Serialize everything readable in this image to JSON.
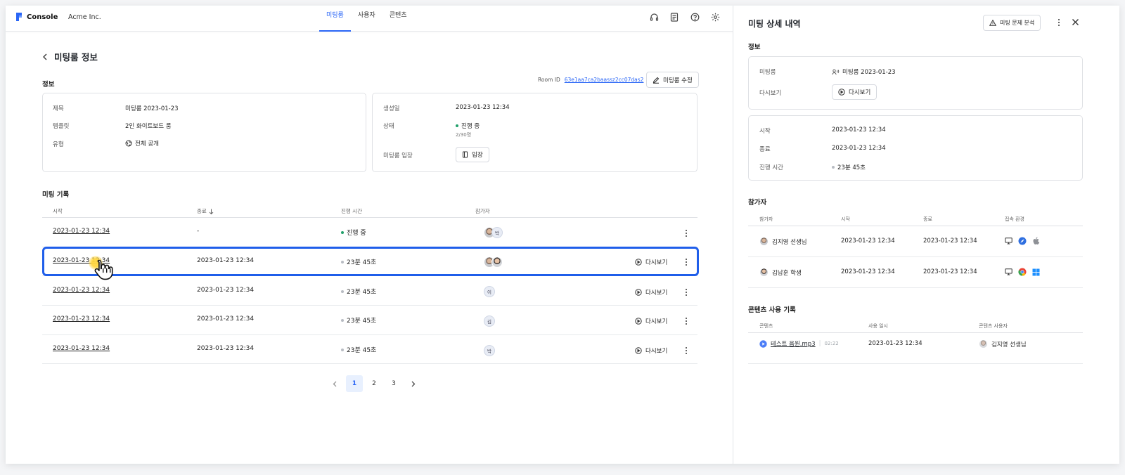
{
  "app": {
    "logo_text": "Console",
    "org_name": "Acme Inc."
  },
  "nav": {
    "tabs": [
      {
        "label": "미팅룸",
        "active": true
      },
      {
        "label": "사용자",
        "active": false
      },
      {
        "label": "콘텐츠",
        "active": false
      }
    ],
    "icons": [
      "headset-icon",
      "document-icon",
      "help-icon",
      "settings-icon"
    ]
  },
  "page": {
    "title": "미팅룸 정보",
    "info_section": "정보",
    "room_id_label": "Room ID",
    "room_id_value": "63e1aa7ca2baassz2cc07das2",
    "edit_button": "미팅룸 수정"
  },
  "info_left": {
    "title_label": "제목",
    "title_value": "미팅룸 2023-01-23",
    "template_label": "템플릿",
    "template_value": "2인 화이트보드 룸",
    "type_label": "유형",
    "type_value": "전체 공개"
  },
  "info_right": {
    "created_label": "생성일",
    "created_value": "2023-01-23 12:34",
    "status_label": "상태",
    "status_value": "진행 중",
    "status_count": "2/30명",
    "enter_label": "미팅룸 입장",
    "enter_button": "입장"
  },
  "records": {
    "section": "미팅 기록",
    "headers": {
      "start": "시작",
      "end": "종료",
      "duration": "진행 시간",
      "participants": "참가자"
    },
    "replay_label": "다시보기",
    "rows": [
      {
        "start": "2023-01-23 12:34",
        "end": "-",
        "duration": "진행 중",
        "live": true,
        "chips": [
          "박"
        ]
      },
      {
        "start": "2023-01-23 12:34",
        "end": "2023-01-23 12:34",
        "duration": "23분 45초",
        "live": false,
        "chips": []
      },
      {
        "start": "2023-01-23 12:34",
        "end": "2023-01-23 12:34",
        "duration": "23분 45초",
        "live": false,
        "chips": [
          "이"
        ]
      },
      {
        "start": "2023-01-23 12:34",
        "end": "2023-01-23 12:34",
        "duration": "23분 45초",
        "live": false,
        "chips": [
          "김"
        ]
      },
      {
        "start": "2023-01-23 12:34",
        "end": "2023-01-23 12:34",
        "duration": "23분 45초",
        "live": false,
        "chips": [
          "박"
        ]
      }
    ],
    "selected_row": 2
  },
  "pagination": {
    "pages": [
      "1",
      "2",
      "3"
    ],
    "current": "1"
  },
  "drawer": {
    "title": "미팅 상세 내역",
    "analyze_button": "미팅 문제 분석",
    "info_section": "정보",
    "room_label": "미팅룸",
    "room_value": "미팅룸 2023-01-23",
    "replay_label": "다시보기",
    "replay_button": "다시보기",
    "start_label": "시작",
    "start_value": "2023-01-23 12:34",
    "end_label": "종료",
    "end_value": "2023-01-23 12:34",
    "duration_label": "진행 시간",
    "duration_value": "23분 45초",
    "participants_section": "참가자",
    "participants_headers": {
      "name": "참가자",
      "start": "시작",
      "end": "종료",
      "env": "접속 환경"
    },
    "participants": [
      {
        "name": "김지영 선생님",
        "start": "2023-01-23 12:34",
        "end": "2023-01-23 12:34",
        "env": [
          "desktop-icon",
          "safari-icon",
          "apple-icon"
        ]
      },
      {
        "name": "김남훈 학생",
        "start": "2023-01-23 12:34",
        "end": "2023-01-23 12:34",
        "env": [
          "desktop-icon",
          "chrome-icon",
          "windows-icon"
        ]
      }
    ],
    "content_section": "콘텐츠 사용 기록",
    "content_headers": {
      "content": "콘텐츠",
      "used_at": "사용 일시",
      "user": "콘텐츠 사용자"
    },
    "content_rows": [
      {
        "name": "테스트 음원.mp3",
        "length": "02:22",
        "used_at": "2023-01-23 12:34",
        "user": "김지영 선생님"
      }
    ]
  },
  "colors": {
    "accent": "#2a66f6",
    "live": "#22a06b",
    "highlight": "#1f5eea"
  }
}
